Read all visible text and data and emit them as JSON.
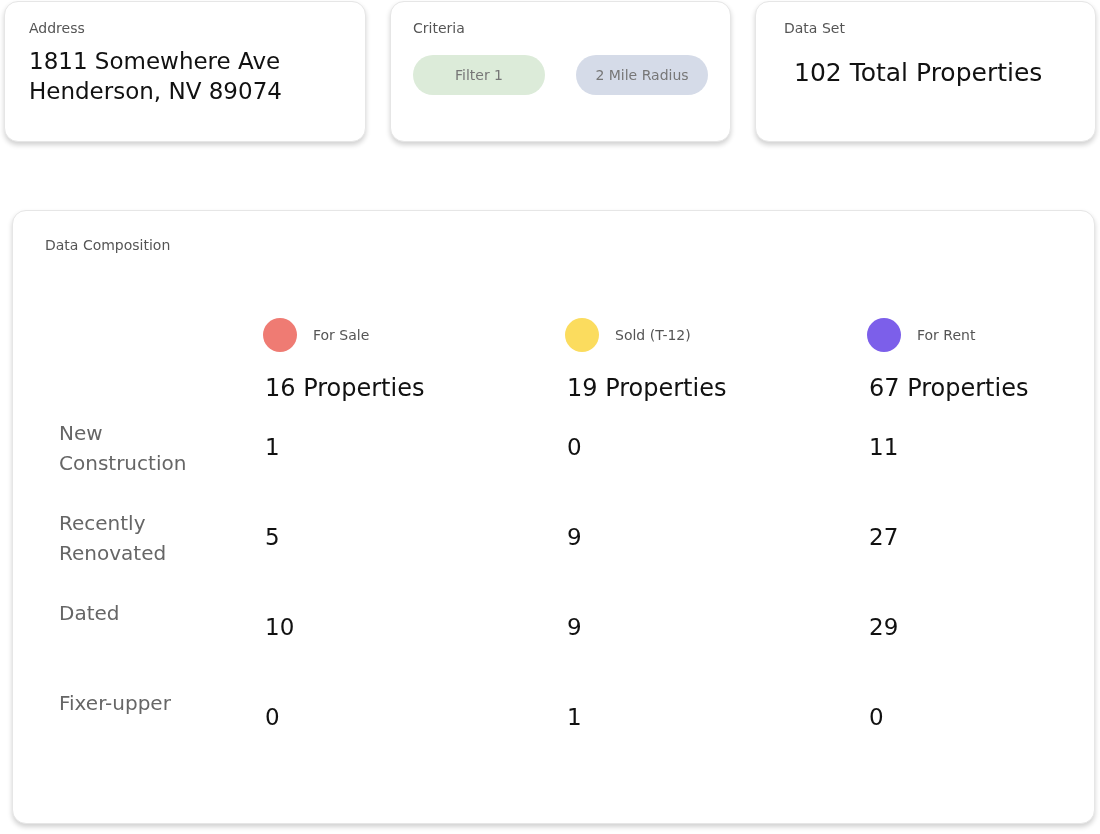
{
  "address": {
    "label": "Address",
    "line1": "1811 Somewhere Ave",
    "line2": "Henderson, NV 89074"
  },
  "criteria": {
    "label": "Criteria",
    "pills": [
      {
        "text": "Filter 1",
        "color": "#dcebd9"
      },
      {
        "text": "2 Mile Radius",
        "color": "#d5dbe8"
      }
    ]
  },
  "data_set": {
    "label": "Data Set",
    "total": "102 Total Properties"
  },
  "composition": {
    "title": "Data Composition",
    "columns": [
      {
        "label": "For Sale",
        "color": "#ef7b73",
        "total": "16 Properties"
      },
      {
        "label": "Sold (T-12)",
        "color": "#fbdc5e",
        "total": "19 Properties"
      },
      {
        "label": "For Rent",
        "color": "#7c5fea",
        "total": "67 Properties"
      }
    ],
    "rows": [
      {
        "label": "New Construction",
        "values": [
          "1",
          "0",
          "11"
        ]
      },
      {
        "label": "Recently Renovated",
        "values": [
          "5",
          "9",
          "27"
        ]
      },
      {
        "label": "Dated",
        "values": [
          "10",
          "9",
          "29"
        ]
      },
      {
        "label": "Fixer-upper",
        "values": [
          "0",
          "1",
          "0"
        ]
      }
    ]
  }
}
